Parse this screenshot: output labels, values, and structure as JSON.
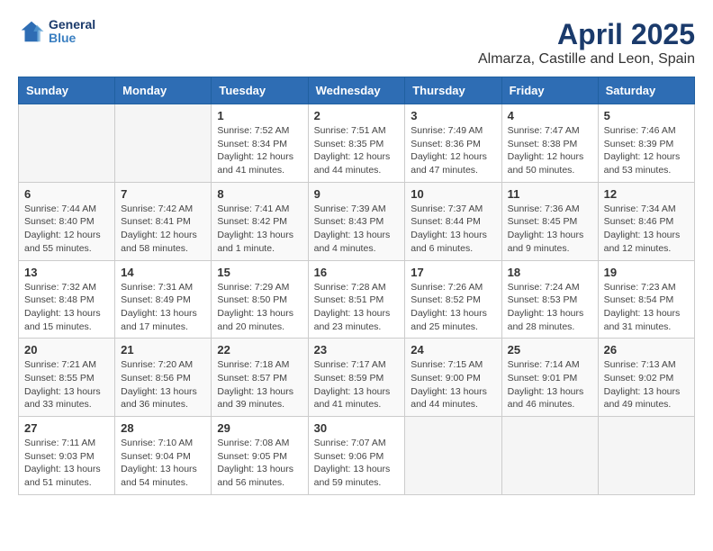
{
  "header": {
    "logo_line1": "General",
    "logo_line2": "Blue",
    "title": "April 2025",
    "subtitle": "Almarza, Castille and Leon, Spain"
  },
  "weekdays": [
    "Sunday",
    "Monday",
    "Tuesday",
    "Wednesday",
    "Thursday",
    "Friday",
    "Saturday"
  ],
  "weeks": [
    [
      {
        "day": "",
        "info": ""
      },
      {
        "day": "",
        "info": ""
      },
      {
        "day": "1",
        "info": "Sunrise: 7:52 AM\nSunset: 8:34 PM\nDaylight: 12 hours and 41 minutes."
      },
      {
        "day": "2",
        "info": "Sunrise: 7:51 AM\nSunset: 8:35 PM\nDaylight: 12 hours and 44 minutes."
      },
      {
        "day": "3",
        "info": "Sunrise: 7:49 AM\nSunset: 8:36 PM\nDaylight: 12 hours and 47 minutes."
      },
      {
        "day": "4",
        "info": "Sunrise: 7:47 AM\nSunset: 8:38 PM\nDaylight: 12 hours and 50 minutes."
      },
      {
        "day": "5",
        "info": "Sunrise: 7:46 AM\nSunset: 8:39 PM\nDaylight: 12 hours and 53 minutes."
      }
    ],
    [
      {
        "day": "6",
        "info": "Sunrise: 7:44 AM\nSunset: 8:40 PM\nDaylight: 12 hours and 55 minutes."
      },
      {
        "day": "7",
        "info": "Sunrise: 7:42 AM\nSunset: 8:41 PM\nDaylight: 12 hours and 58 minutes."
      },
      {
        "day": "8",
        "info": "Sunrise: 7:41 AM\nSunset: 8:42 PM\nDaylight: 13 hours and 1 minute."
      },
      {
        "day": "9",
        "info": "Sunrise: 7:39 AM\nSunset: 8:43 PM\nDaylight: 13 hours and 4 minutes."
      },
      {
        "day": "10",
        "info": "Sunrise: 7:37 AM\nSunset: 8:44 PM\nDaylight: 13 hours and 6 minutes."
      },
      {
        "day": "11",
        "info": "Sunrise: 7:36 AM\nSunset: 8:45 PM\nDaylight: 13 hours and 9 minutes."
      },
      {
        "day": "12",
        "info": "Sunrise: 7:34 AM\nSunset: 8:46 PM\nDaylight: 13 hours and 12 minutes."
      }
    ],
    [
      {
        "day": "13",
        "info": "Sunrise: 7:32 AM\nSunset: 8:48 PM\nDaylight: 13 hours and 15 minutes."
      },
      {
        "day": "14",
        "info": "Sunrise: 7:31 AM\nSunset: 8:49 PM\nDaylight: 13 hours and 17 minutes."
      },
      {
        "day": "15",
        "info": "Sunrise: 7:29 AM\nSunset: 8:50 PM\nDaylight: 13 hours and 20 minutes."
      },
      {
        "day": "16",
        "info": "Sunrise: 7:28 AM\nSunset: 8:51 PM\nDaylight: 13 hours and 23 minutes."
      },
      {
        "day": "17",
        "info": "Sunrise: 7:26 AM\nSunset: 8:52 PM\nDaylight: 13 hours and 25 minutes."
      },
      {
        "day": "18",
        "info": "Sunrise: 7:24 AM\nSunset: 8:53 PM\nDaylight: 13 hours and 28 minutes."
      },
      {
        "day": "19",
        "info": "Sunrise: 7:23 AM\nSunset: 8:54 PM\nDaylight: 13 hours and 31 minutes."
      }
    ],
    [
      {
        "day": "20",
        "info": "Sunrise: 7:21 AM\nSunset: 8:55 PM\nDaylight: 13 hours and 33 minutes."
      },
      {
        "day": "21",
        "info": "Sunrise: 7:20 AM\nSunset: 8:56 PM\nDaylight: 13 hours and 36 minutes."
      },
      {
        "day": "22",
        "info": "Sunrise: 7:18 AM\nSunset: 8:57 PM\nDaylight: 13 hours and 39 minutes."
      },
      {
        "day": "23",
        "info": "Sunrise: 7:17 AM\nSunset: 8:59 PM\nDaylight: 13 hours and 41 minutes."
      },
      {
        "day": "24",
        "info": "Sunrise: 7:15 AM\nSunset: 9:00 PM\nDaylight: 13 hours and 44 minutes."
      },
      {
        "day": "25",
        "info": "Sunrise: 7:14 AM\nSunset: 9:01 PM\nDaylight: 13 hours and 46 minutes."
      },
      {
        "day": "26",
        "info": "Sunrise: 7:13 AM\nSunset: 9:02 PM\nDaylight: 13 hours and 49 minutes."
      }
    ],
    [
      {
        "day": "27",
        "info": "Sunrise: 7:11 AM\nSunset: 9:03 PM\nDaylight: 13 hours and 51 minutes."
      },
      {
        "day": "28",
        "info": "Sunrise: 7:10 AM\nSunset: 9:04 PM\nDaylight: 13 hours and 54 minutes."
      },
      {
        "day": "29",
        "info": "Sunrise: 7:08 AM\nSunset: 9:05 PM\nDaylight: 13 hours and 56 minutes."
      },
      {
        "day": "30",
        "info": "Sunrise: 7:07 AM\nSunset: 9:06 PM\nDaylight: 13 hours and 59 minutes."
      },
      {
        "day": "",
        "info": ""
      },
      {
        "day": "",
        "info": ""
      },
      {
        "day": "",
        "info": ""
      }
    ]
  ]
}
